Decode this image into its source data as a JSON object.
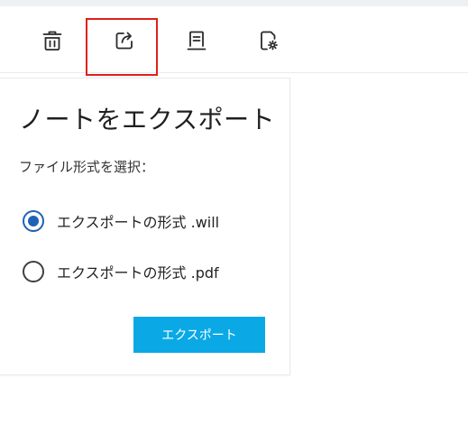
{
  "toolbar": {
    "items": [
      {
        "name": "delete",
        "icon": "trash-icon"
      },
      {
        "name": "export",
        "icon": "export-icon",
        "highlighted": true
      },
      {
        "name": "document",
        "icon": "document-icon"
      },
      {
        "name": "settings",
        "icon": "document-settings-icon"
      }
    ]
  },
  "export_panel": {
    "title": "ノートをエクスポート",
    "subtitle": "ファイル形式を選択：",
    "options": [
      {
        "label": "エクスポートの形式 .will",
        "checked": true
      },
      {
        "label": "エクスポートの形式 .pdf",
        "checked": false
      }
    ],
    "button_label": "エクスポート"
  },
  "colors": {
    "accent": "#0aa9e6",
    "radio_selected": "#1e63b4",
    "highlight_border": "#e0201b"
  }
}
